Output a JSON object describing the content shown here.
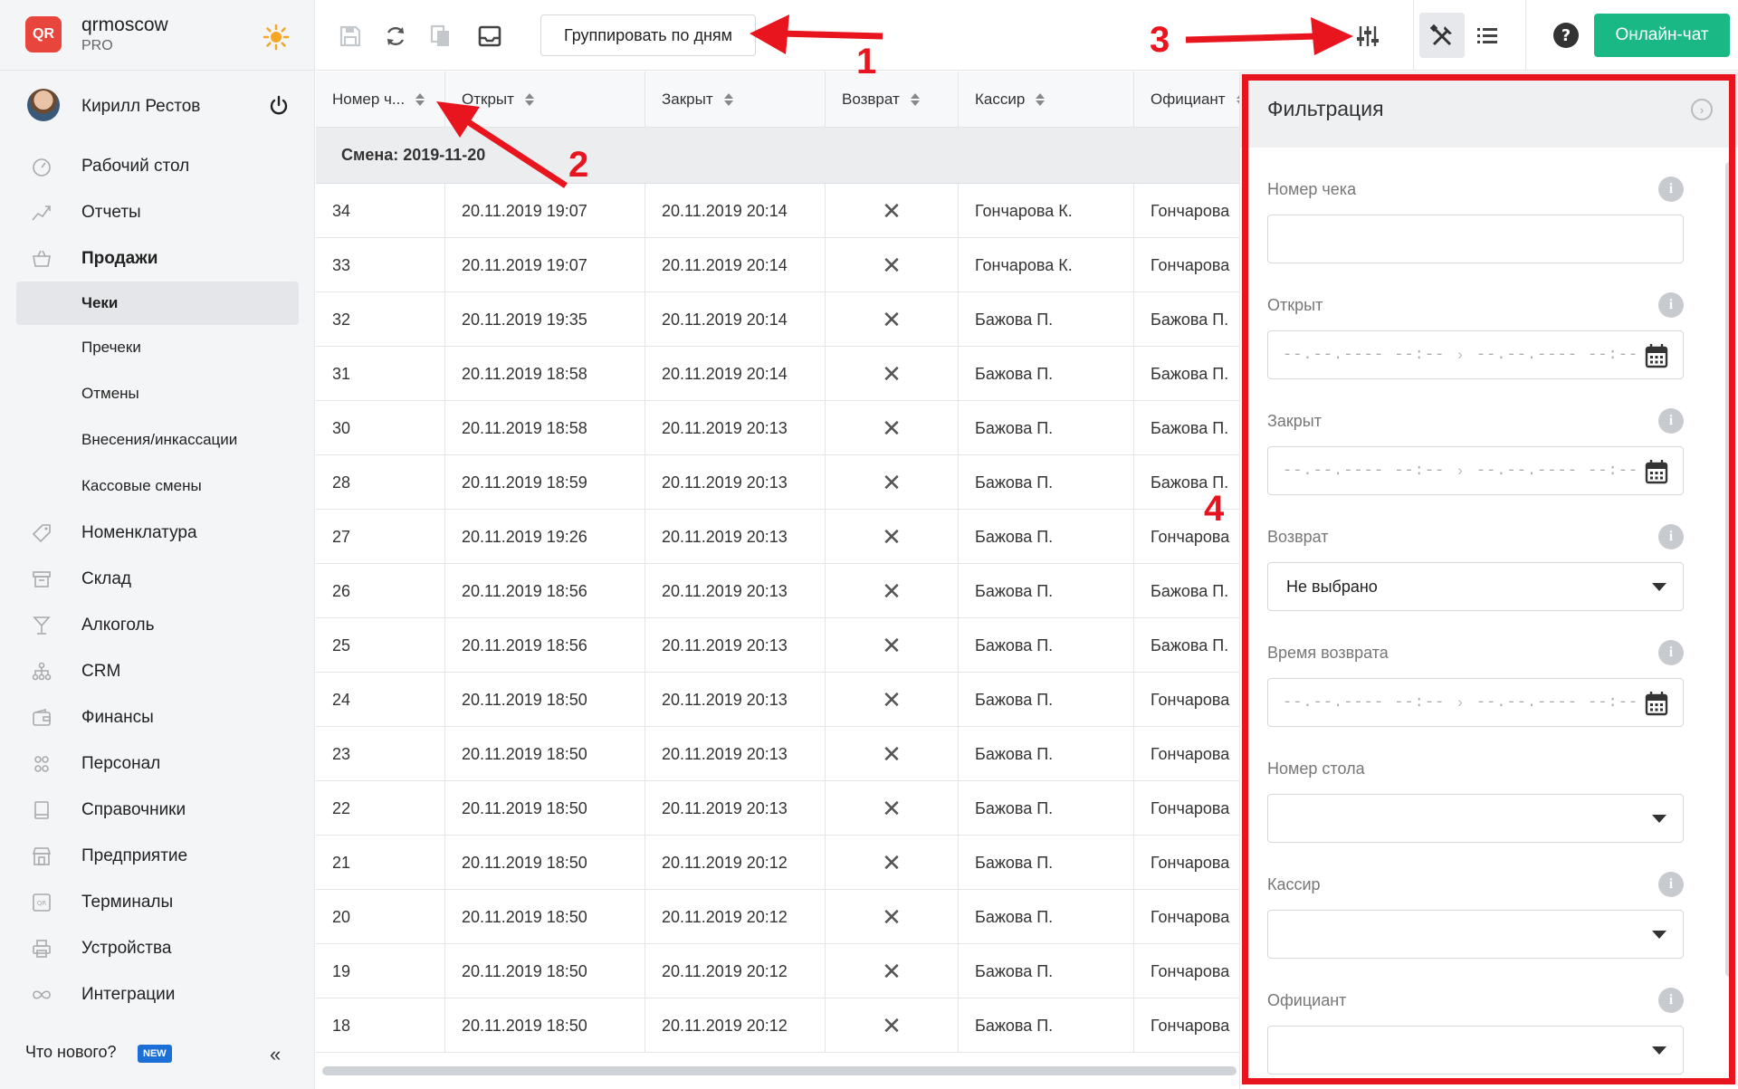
{
  "brand": {
    "name": "qrmoscow",
    "plan": "PRO",
    "logo_text": "QR"
  },
  "user": {
    "name": "Кирилл Рестов"
  },
  "nav": {
    "items": [
      {
        "label": "Рабочий стол",
        "icon": "dashboard-icon"
      },
      {
        "label": "Отчеты",
        "icon": "chart-icon"
      },
      {
        "label": "Продажи",
        "icon": "basket-icon"
      }
    ],
    "sales_sub": [
      "Чеки",
      "Пречеки",
      "Отмены",
      "Внесения/инкассации",
      "Кассовые смены"
    ],
    "items2": [
      {
        "label": "Номенклатура",
        "icon": "tag-icon"
      },
      {
        "label": "Склад",
        "icon": "box-icon"
      },
      {
        "label": "Алкоголь",
        "icon": "glass-icon"
      },
      {
        "label": "CRM",
        "icon": "crm-icon"
      },
      {
        "label": "Финансы",
        "icon": "wallet-icon"
      },
      {
        "label": "Персонал",
        "icon": "people-icon"
      },
      {
        "label": "Справочники",
        "icon": "book-icon"
      },
      {
        "label": "Предприятие",
        "icon": "store-icon"
      },
      {
        "label": "Терминалы",
        "icon": "terminal-icon"
      },
      {
        "label": "Устройства",
        "icon": "printer-icon"
      },
      {
        "label": "Интеграции",
        "icon": "infinity-icon"
      }
    ]
  },
  "footer": {
    "whats_new": "Что нового?",
    "new_badge": "NEW",
    "collapse": "«"
  },
  "toolbar": {
    "group_label": "Группировать по дням",
    "chat_label": "Онлайн-чат"
  },
  "table": {
    "columns": [
      "Номер ч...",
      "Открыт",
      "Закрыт",
      "Возврат",
      "Кассир",
      "Официант"
    ],
    "group_label": "Смена: 2019-11-20",
    "return_mark": "✕",
    "rows": [
      [
        "34",
        "20.11.2019 19:07",
        "20.11.2019 20:14",
        "Гончарова К.",
        "Гончарова"
      ],
      [
        "33",
        "20.11.2019 19:07",
        "20.11.2019 20:14",
        "Гончарова К.",
        "Гончарова"
      ],
      [
        "32",
        "20.11.2019 19:35",
        "20.11.2019 20:14",
        "Бажова П.",
        "Бажова П."
      ],
      [
        "31",
        "20.11.2019 18:58",
        "20.11.2019 20:14",
        "Бажова П.",
        "Бажова П."
      ],
      [
        "30",
        "20.11.2019 18:58",
        "20.11.2019 20:13",
        "Бажова П.",
        "Бажова П."
      ],
      [
        "28",
        "20.11.2019 18:59",
        "20.11.2019 20:13",
        "Бажова П.",
        "Бажова П."
      ],
      [
        "27",
        "20.11.2019 19:26",
        "20.11.2019 20:13",
        "Бажова П.",
        "Гончарова"
      ],
      [
        "26",
        "20.11.2019 18:56",
        "20.11.2019 20:13",
        "Бажова П.",
        "Бажова П."
      ],
      [
        "25",
        "20.11.2019 18:56",
        "20.11.2019 20:13",
        "Бажова П.",
        "Бажова П."
      ],
      [
        "24",
        "20.11.2019 18:50",
        "20.11.2019 20:13",
        "Бажова П.",
        "Гончарова"
      ],
      [
        "23",
        "20.11.2019 18:50",
        "20.11.2019 20:13",
        "Бажова П.",
        "Гончарова"
      ],
      [
        "22",
        "20.11.2019 18:50",
        "20.11.2019 20:13",
        "Бажова П.",
        "Гончарова"
      ],
      [
        "21",
        "20.11.2019 18:50",
        "20.11.2019 20:12",
        "Бажова П.",
        "Гончарова"
      ],
      [
        "20",
        "20.11.2019 18:50",
        "20.11.2019 20:12",
        "Бажова П.",
        "Гончарова"
      ],
      [
        "19",
        "20.11.2019 18:50",
        "20.11.2019 20:12",
        "Бажова П.",
        "Гончарова"
      ],
      [
        "18",
        "20.11.2019 18:50",
        "20.11.2019 20:12",
        "Бажова П.",
        "Гончарова"
      ]
    ]
  },
  "filter": {
    "title": "Фильтрация",
    "info_mark": "i",
    "date_placeholder": "--.--.---- --:--",
    "range_arrow": "›",
    "fields": {
      "receipt_number": "Номер чека",
      "opened": "Открыт",
      "closed": "Закрыт",
      "refund": "Возврат",
      "refund_value": "Не выбрано",
      "refund_time": "Время возврата",
      "table_number": "Номер стола",
      "cashier": "Кассир",
      "waiter": "Официант"
    }
  },
  "annotations": [
    "1",
    "2",
    "3",
    "4"
  ],
  "colors": {
    "accent_green": "#1ab885",
    "annotation_red": "#e8141e",
    "logo_red": "#e8453c",
    "new_badge_blue": "#1d6fd8"
  }
}
